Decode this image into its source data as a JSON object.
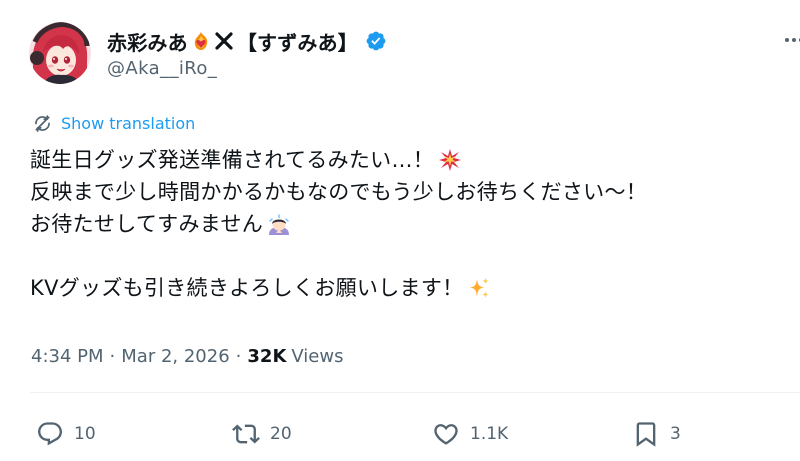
{
  "author": {
    "display_name": "赤彩みあ",
    "display_name_suffix": "【すずみあ】",
    "name_emoji": "heart-on-fire-emoji",
    "separator_icon": "x-mark-icon",
    "verified": true,
    "handle": "@Aka__iRo_"
  },
  "translation": {
    "label": "Show translation"
  },
  "tweet": {
    "lines": [
      "誕生日グッズ発送準備されてるみたい…！",
      "反映まで少し時間かかるかもなのでもう少しお待ちください〜！",
      "お待たせしてすみません",
      "",
      "KVグッズも引き続きよろしくお願いします！"
    ],
    "emojis": {
      "line1": "collision-emoji",
      "line3": "person-bowing-emoji",
      "line5": "sparkles-emoji"
    }
  },
  "meta": {
    "time": "4:34 PM",
    "sep1": "·",
    "date": "Mar 2, 2026",
    "sep2": "·",
    "views_count": "32K",
    "views_label": "Views"
  },
  "actions": {
    "replies": "10",
    "retweets": "20",
    "likes": "1.1K",
    "bookmarks": "3"
  },
  "colors": {
    "text": "#0f1419",
    "secondary": "#536471",
    "link": "#1d9bf0",
    "verified": "#1d9bf0"
  }
}
